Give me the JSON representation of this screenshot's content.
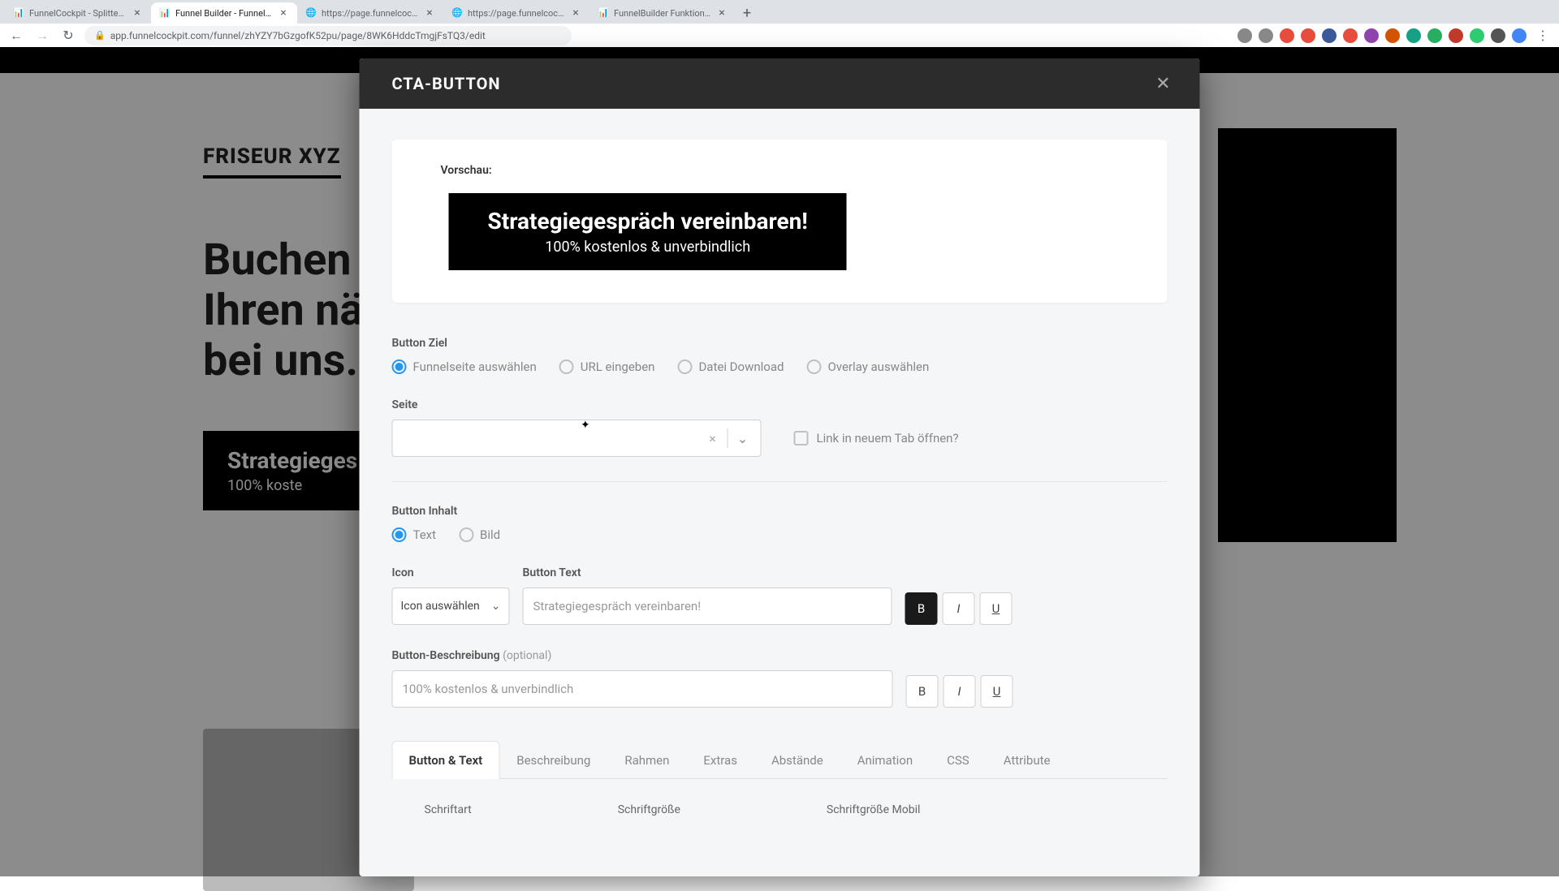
{
  "browser": {
    "tabs": [
      {
        "title": "FunnelCockpit - Splittests, Ma"
      },
      {
        "title": "Funnel Builder - FunnelCockpit"
      },
      {
        "title": "https://page.funnelcockpit.co"
      },
      {
        "title": "https://page.funnelcockpit.co"
      },
      {
        "title": "FunnelBuilder Funktionen & El"
      }
    ],
    "url": "app.funnelcockpit.com/funnel/zhYZY7bGzgofK52pu/page/8WK6HddcTmgjFsTQ3/edit"
  },
  "background": {
    "brand": "FRISEUR XYZ",
    "headline_l1": "Buchen Si",
    "headline_l2": "Ihren näch",
    "headline_l3": "bei uns. W",
    "cta_title": "Strategieges",
    "cta_sub": "100% koste"
  },
  "modal": {
    "title": "CTA-BUTTON",
    "preview_label": "Vorschau:",
    "preview_btn_title": "Strategiegespräch vereinbaren!",
    "preview_btn_sub": "100% kostenlos & unverbindlich",
    "section_ziel": "Button Ziel",
    "ziel_options": {
      "funnelseite": "Funnelseite auswählen",
      "url": "URL eingeben",
      "datei": "Datei Download",
      "overlay": "Overlay auswählen"
    },
    "seite_label": "Seite",
    "checkbox_newtab": "Link in neuem Tab öffnen?",
    "section_inhalt": "Button Inhalt",
    "inhalt_options": {
      "text": "Text",
      "bild": "Bild"
    },
    "icon_label": "Icon",
    "icon_placeholder": "Icon auswählen",
    "btn_text_label": "Button Text",
    "btn_text_value": "Strategiegespräch vereinbaren!",
    "btn_desc_label": "Button-Beschreibung",
    "btn_desc_optional": "(optional)",
    "btn_desc_value": "100% kostenlos & unverbindlich",
    "fmt": {
      "bold": "B",
      "italic": "I",
      "underline": "U"
    },
    "tabs": {
      "button_text": "Button & Text",
      "beschreibung": "Beschreibung",
      "rahmen": "Rahmen",
      "extras": "Extras",
      "abstaende": "Abstände",
      "animation": "Animation",
      "css": "CSS",
      "attribute": "Attribute"
    },
    "bottom": {
      "schriftart": "Schriftart",
      "schriftgroesse": "Schriftgröße",
      "schriftgroesse_mobil": "Schriftgröße Mobil"
    }
  }
}
